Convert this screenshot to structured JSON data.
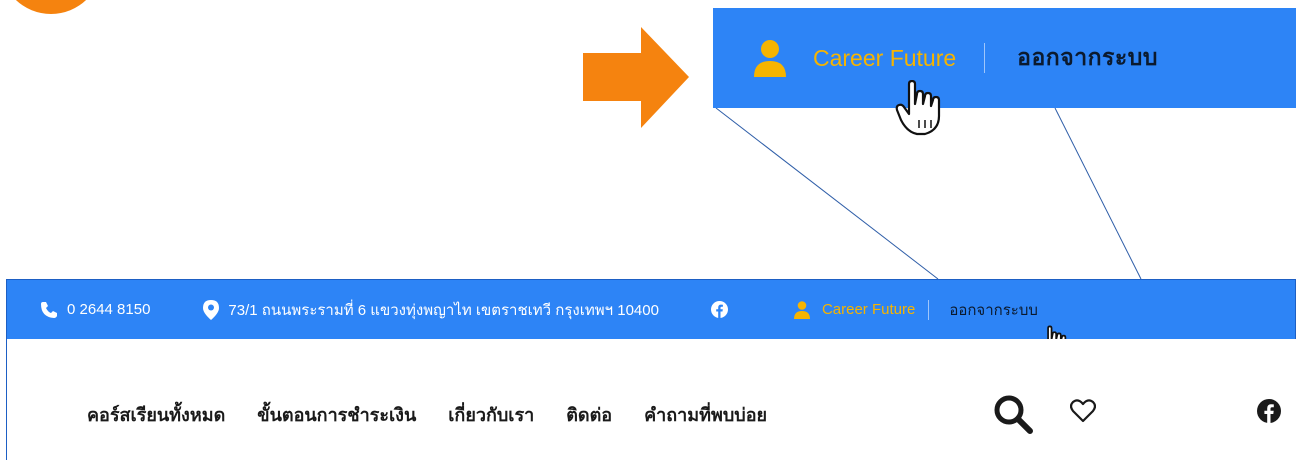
{
  "zoom": {
    "user_label": "Career Future",
    "logout_label": "ออกจากระบบ"
  },
  "topbar": {
    "phone": "0 2644 8150",
    "address": "73/1 ถนนพระรามที่ 6 แขวงทุ่งพญาไท เขตราชเทวี กรุงเทพฯ 10400",
    "user_label": "Career Future",
    "logout_label": "ออกจากระบบ"
  },
  "nav": {
    "items": [
      {
        "label": "คอร์สเรียนทั้งหมด"
      },
      {
        "label": "ขั้นตอนการชำระเงิน"
      },
      {
        "label": "เกี่ยวกับเรา"
      },
      {
        "label": "ติดต่อ"
      },
      {
        "label": "คำถามที่พบบ่อย"
      }
    ]
  },
  "icons": [
    "phone-icon",
    "map-pin-icon",
    "facebook-icon",
    "user-icon",
    "search-icon",
    "heart-icon",
    "hand-cursor-icon",
    "arrow-right-icon"
  ],
  "colors": {
    "bar_blue": "#2d84f6",
    "accent_orange": "#f5830f",
    "user_gold": "#f6b400"
  }
}
